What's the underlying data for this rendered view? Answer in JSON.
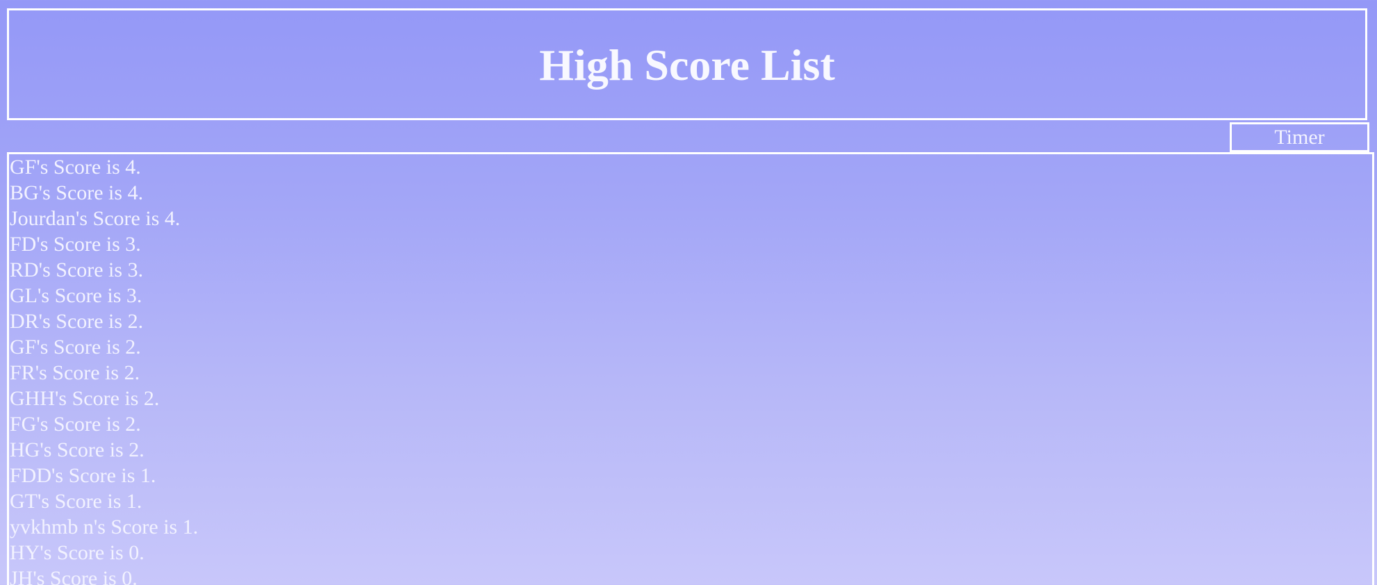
{
  "header": {
    "title": "High Score List"
  },
  "timer": {
    "label": "Timer"
  },
  "scores": [
    "GF's Score is 4.",
    "BG's Score is 4.",
    "Jourdan's Score is 4.",
    "FD's Score is 3.",
    "RD's Score is 3.",
    "GL's Score is 3.",
    "DR's Score is 2.",
    "GF's Score is 2.",
    "FR's Score is 2.",
    "GHH's Score is 2.",
    "FG's Score is 2.",
    "HG's Score is 2.",
    "FDD's Score is 1.",
    "GT's Score is 1.",
    "yvkhmb n's Score is 1.",
    "HY's Score is 0.",
    "JH's Score is 0."
  ],
  "colors": {
    "background_top": "#9498f7",
    "background_bottom": "#c8c7fa",
    "border": "#ffffff",
    "text": "#ffffff"
  }
}
